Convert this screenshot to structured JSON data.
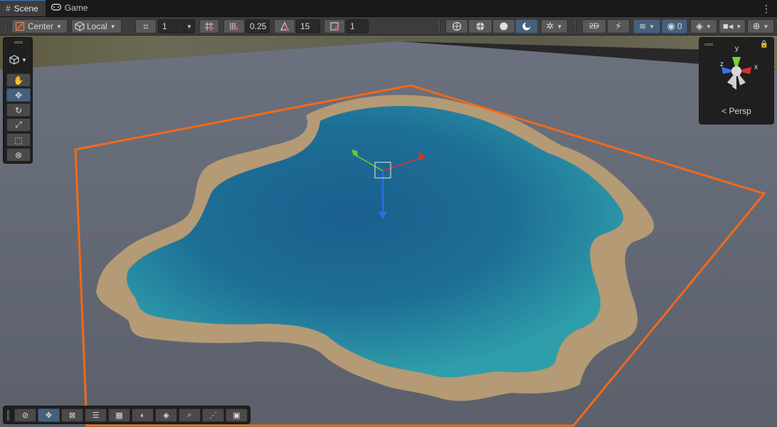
{
  "tabs": [
    {
      "label": "Scene",
      "icon": "grid-icon",
      "active": true
    },
    {
      "label": "Game",
      "icon": "gamepad-icon",
      "active": false
    }
  ],
  "toolbar": {
    "pivot_mode": "Center",
    "pivot_rotation": "Local",
    "grid_size": "1",
    "snap_increment": "0.25",
    "rotate_snap": "15",
    "scale_snap": "1",
    "visibility_count": "0"
  },
  "gizmo": {
    "projection_label": "Persp",
    "axis_x": "x",
    "axis_y": "y",
    "axis_z": "z"
  },
  "colors": {
    "selection_outline": "#f06a1a",
    "accent_selected": "#46607c",
    "x_axis": "#d9342b",
    "y_axis": "#6bc72e",
    "z_axis": "#2f6fe6",
    "water": "#1b6c92"
  },
  "scene_tools": [
    "hand-tool-icon",
    "move-tool-icon",
    "rotate-tool-icon",
    "scale-tool-icon",
    "rect-tool-icon",
    "transform-tool-icon"
  ],
  "overlay_tools": [
    "orientation-icon",
    "move-overlay-icon",
    "terrain-icon",
    "settings-sliders-icon",
    "grid-overlay-icon",
    "lighting-icon",
    "layers-icon",
    "search-icon",
    "nodes-icon",
    "camera-icon"
  ]
}
